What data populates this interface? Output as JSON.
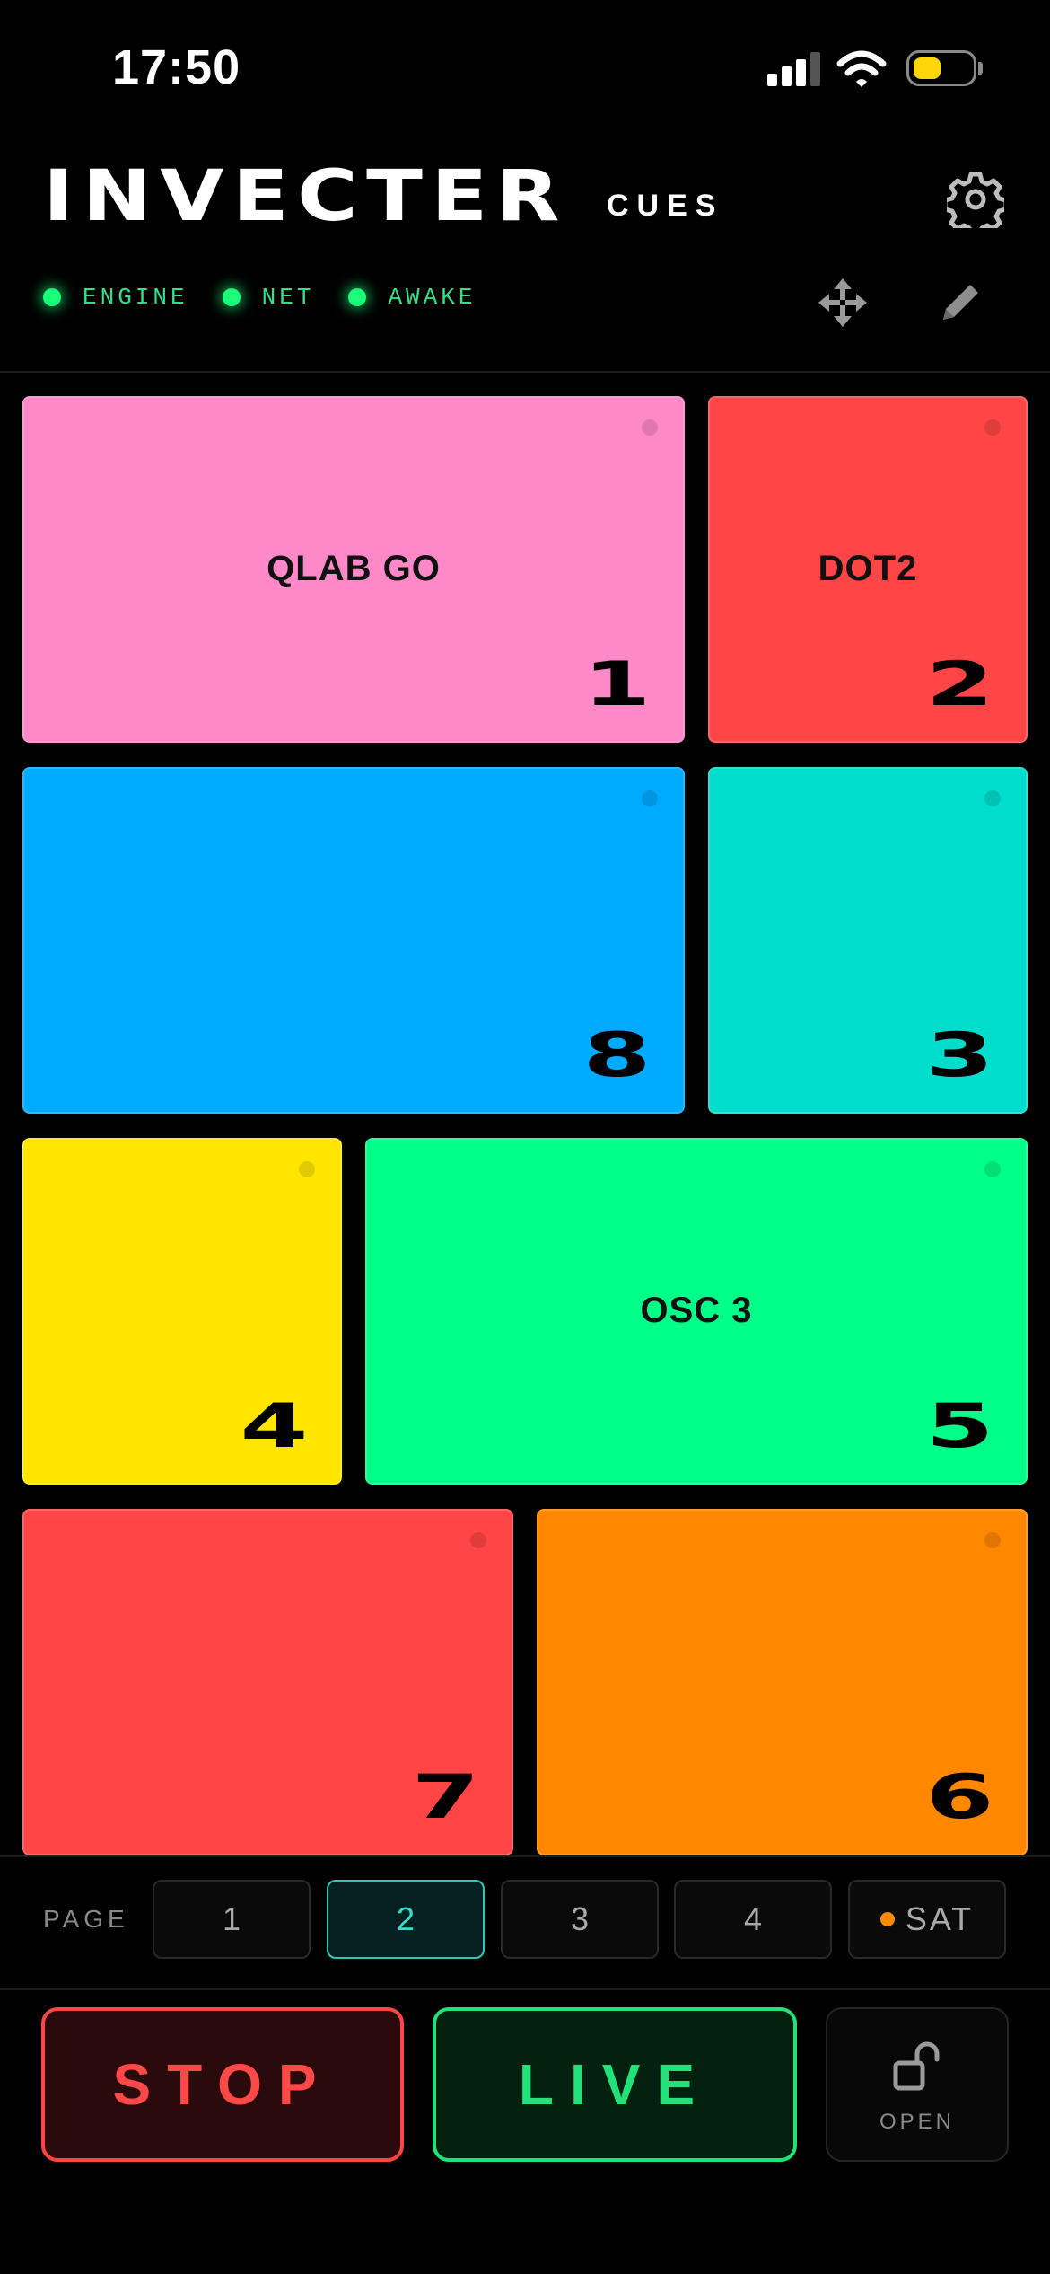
{
  "status_bar": {
    "time": "17:50",
    "battery_color": "#ffd60a"
  },
  "header": {
    "brand": "INVECTER",
    "subtitle": "CUES"
  },
  "indicators": [
    {
      "label": "ENGINE",
      "color": "#19ff7a"
    },
    {
      "label": "NET",
      "color": "#19ff7a"
    },
    {
      "label": "AWAKE",
      "color": "#19ff7a"
    }
  ],
  "icons": {
    "settings": "gear-icon",
    "move": "move-arrows-icon",
    "edit": "pencil-icon",
    "lock": "unlocked-padlock-icon"
  },
  "pads": [
    {
      "label": "QLAB GO",
      "number": "1",
      "color": "#ff88c8"
    },
    {
      "label": "DOT2",
      "number": "2",
      "color": "#ff4545"
    },
    {
      "label": "",
      "number": "8",
      "color": "#00aaff"
    },
    {
      "label": "",
      "number": "3",
      "color": "#00ddcc"
    },
    {
      "label": "",
      "number": "4",
      "color": "#ffe600"
    },
    {
      "label": "OSC 3",
      "number": "5",
      "color": "#00ff88"
    },
    {
      "label": "",
      "number": "7",
      "color": "#ff4545"
    },
    {
      "label": "",
      "number": "6",
      "color": "#ff8800"
    }
  ],
  "pages": {
    "label": "PAGE",
    "buttons": [
      "1",
      "2",
      "3",
      "4"
    ],
    "active": "2",
    "sat_label": "SAT",
    "sat_color": "#ff8a00"
  },
  "controls": {
    "stop": "STOP",
    "live": "LIVE",
    "open": "OPEN"
  }
}
